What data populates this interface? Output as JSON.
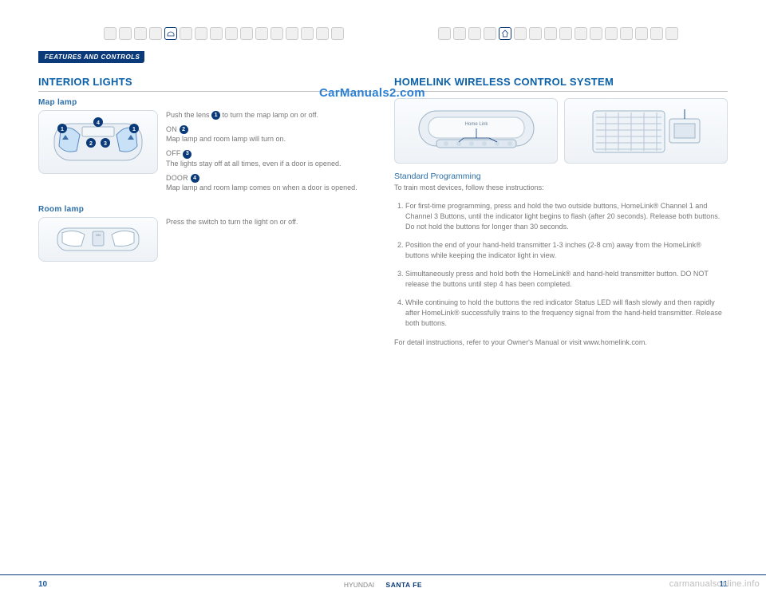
{
  "section_tab": "FEATURES AND CONTROLS",
  "watermark": "CarManuals2.com",
  "left": {
    "title": "INTERIOR LIGHTS",
    "map_lamp": {
      "heading": "Map lamp",
      "p1a": "Push the lens ",
      "p1b": " to turn the map lamp on or off.",
      "on_label": "ON ",
      "on_body": "Map lamp and room lamp will turn on.",
      "off_label": "OFF ",
      "off_body": "The lights stay off at all times, even if a door is opened.",
      "door_label": "DOOR ",
      "door_body": "Map lamp and room lamp comes on when a door is opened.",
      "n1": "1",
      "n2": "2",
      "n3": "3",
      "n4": "4"
    },
    "room_lamp": {
      "heading": "Room lamp",
      "body": "Press the switch to turn the light on or off."
    }
  },
  "right": {
    "title": "HOMELINK WIRELESS CONTROL SYSTEM",
    "mirror_label": "Home Link",
    "std_heading": "Standard Programming",
    "std_intro": "To train most devices, follow these instructions:",
    "steps": [
      "For first-time programming, press and hold the two outside buttons, HomeLink® Channel 1 and Channel 3 Buttons, until the indicator light begins to flash (after 20 seconds). Release both buttons. Do not hold the buttons for longer than 30 seconds.",
      "Position the end of your hand-held transmitter 1-3 inches (2-8 cm) away from the HomeLink® buttons while keeping the indicator light in view.",
      "Simultaneously press and hold both the HomeLink® and hand-held transmitter button. DO NOT release the buttons until step 4 has been completed.",
      "While continuing to hold the buttons the red indicator Status LED will flash slowly and then rapidly after HomeLink® successfully trains to the frequency signal from the hand-held transmitter. Release both buttons."
    ],
    "closing": "For detail instructions, refer to your Owner's Manual or visit www.homelink.com."
  },
  "footer": {
    "page_left": "10",
    "brand": "HYUNDAI",
    "model": "SANTA FE",
    "page_right": "11"
  },
  "site_watermark": "carmanualsonline.info",
  "icon_names_left": [
    "icon",
    "icon",
    "icon",
    "icon",
    "car-icon",
    "icon",
    "icon",
    "icon",
    "icon",
    "icon",
    "icon",
    "icon",
    "icon",
    "icon",
    "icon",
    "eco-icon"
  ],
  "icon_names_right": [
    "icon",
    "icon",
    "icon",
    "icon",
    "home-icon",
    "icon",
    "icon",
    "icon",
    "icon",
    "icon",
    "icon",
    "icon",
    "icon",
    "icon",
    "icon",
    "icon"
  ]
}
